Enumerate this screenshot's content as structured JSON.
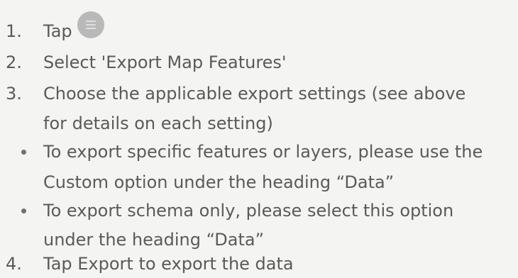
{
  "steps": [
    {
      "num": "1.",
      "text": "Tap",
      "icon": "menu-icon"
    },
    {
      "num": "2.",
      "text": "Select 'Export Map Features'"
    },
    {
      "num": "3.",
      "lines": [
        "Choose the applicable export settings (see above",
        "for details on each setting)"
      ]
    }
  ],
  "bullets": [
    {
      "lines": [
        "To export specific features or layers, please use the",
        "Custom option under the heading “Data”"
      ]
    },
    {
      "lines": [
        "To export schema only, please select this option",
        "under the heading “Data”"
      ]
    }
  ],
  "final_step": {
    "num": "4.",
    "text": "Tap Export to export the data"
  }
}
